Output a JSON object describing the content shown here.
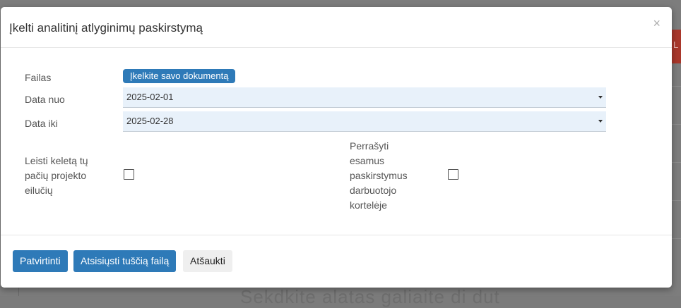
{
  "background": {
    "partial_button_text": "L",
    "partial_heading": "Sekdkite alatas galiaite di dut"
  },
  "modal": {
    "title": "Įkelti analitinį atlyginimų paskirstymą",
    "close_glyph": "×"
  },
  "form": {
    "file_label": "Failas",
    "upload_label": "Įkelkite savo dokumentą",
    "date_from_label": "Data nuo",
    "date_from_value": "2025-02-01",
    "date_to_label": "Data iki",
    "date_to_value": "2025-02-28",
    "allow_multiple_label_lines": [
      "Leisti keletą tų",
      "pačių projekto",
      "eilučių"
    ],
    "overwrite_label_lines": [
      "Perrašyti",
      "esamus",
      "paskirstymus",
      "darbuotojo",
      "kortelėje"
    ],
    "allow_multiple_checked": false,
    "overwrite_checked": false
  },
  "footer": {
    "confirm_label": "Patvirtinti",
    "download_label": "Atsisiųsti tuščią failą",
    "cancel_label": "Atšaukti"
  },
  "colors": {
    "primary": "#2e7ab8",
    "select_bg": "#e8f1fa",
    "backdrop": "#7d7d7d"
  }
}
